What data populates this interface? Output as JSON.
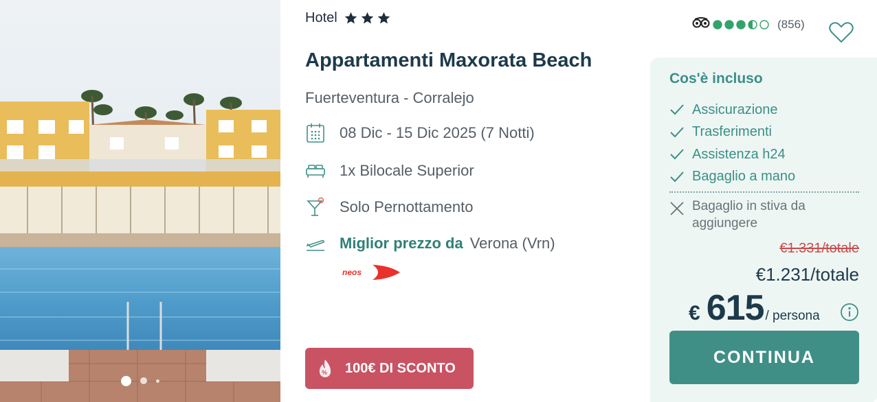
{
  "hotel": {
    "type_label": "Hotel",
    "stars": 3,
    "name": "Appartamenti Maxorata Beach",
    "location": "Fuerteventura - Corralejo"
  },
  "photo": {
    "subject": "hotel pool and apartments",
    "carousel_pages": 3,
    "active_page": 1
  },
  "details": {
    "dates": "08 Dic - 15 Dic 2025 (7 Notti)",
    "room": "1x Bilocale Superior",
    "board": "Solo Pernottamento",
    "flight_label": "Miglior prezzo da",
    "flight_origin": "Verona (Vrn)",
    "airline_logo_text": "neos"
  },
  "promo": {
    "label": "100€ DI SCONTO"
  },
  "rating": {
    "score": 3.5,
    "max": 5,
    "count": "(856)",
    "icon": "tripadvisor-icon"
  },
  "included": {
    "title": "Cos'è incluso",
    "items": [
      {
        "label": "Assicurazione"
      },
      {
        "label": "Trasferimenti"
      },
      {
        "label": "Assistenza h24"
      },
      {
        "label": "Bagaglio a mano"
      }
    ],
    "excluded": [
      {
        "label": "Bagaglio in stiva da aggiungere"
      }
    ]
  },
  "pricing": {
    "old_total": "€1.331/totale",
    "total": "€1.231/totale",
    "currency": "€",
    "per_person": "615",
    "per_person_unit": "/ persona"
  },
  "cta": {
    "label": "CONTINUA"
  },
  "colors": {
    "brand_teal": "#3f8f86",
    "promo_red": "#c95363",
    "rating_green": "#34a36b",
    "panel_bg": "#eef6f4"
  }
}
